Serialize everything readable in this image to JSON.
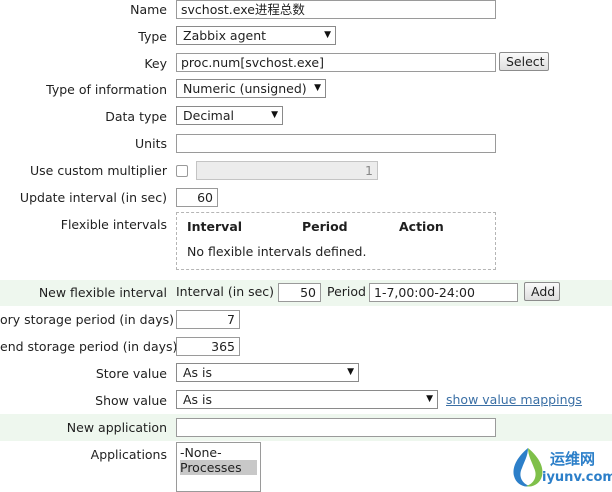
{
  "form": {
    "name": {
      "label": "Name",
      "value": "svchost.exe进程总数"
    },
    "type": {
      "label": "Type",
      "value": "Zabbix agent"
    },
    "key": {
      "label": "Key",
      "value": "proc.num[svchost.exe]",
      "button": "Select"
    },
    "type_of_information": {
      "label": "Type of information",
      "value": "Numeric (unsigned)"
    },
    "data_type": {
      "label": "Data type",
      "value": "Decimal"
    },
    "units": {
      "label": "Units",
      "value": ""
    },
    "custom_multiplier": {
      "label": "Use custom multiplier",
      "checked": false,
      "value": "1"
    },
    "update_interval": {
      "label": "Update interval (in sec)",
      "value": "60"
    },
    "flexible_intervals": {
      "label": "Flexible intervals",
      "columns": [
        "Interval",
        "Period",
        "Action"
      ],
      "empty_text": "No flexible intervals defined."
    },
    "new_flexible_interval": {
      "label": "New flexible interval",
      "interval_label": "Interval (in sec)",
      "interval_value": "50",
      "period_label": "Period",
      "period_value": "1-7,00:00-24:00",
      "button": "Add"
    },
    "history_storage": {
      "label": "ory storage period (in days)",
      "value": "7"
    },
    "trend_storage": {
      "label": "end storage period (in days)",
      "value": "365"
    },
    "store_value": {
      "label": "Store value",
      "value": "As is"
    },
    "show_value": {
      "label": "Show value",
      "value": "As is",
      "link": "show value mappings"
    },
    "new_application": {
      "label": "New application",
      "value": ""
    },
    "applications": {
      "label": "Applications",
      "options": [
        "-None-",
        "Processes"
      ],
      "selected": "Processes"
    }
  },
  "watermark": {
    "text_cn": "运维网",
    "text_url": "iyunv.com"
  },
  "colors": {
    "band": "#eef7ee",
    "link": "#3a6fa5",
    "accent": "#2c7fc9"
  }
}
